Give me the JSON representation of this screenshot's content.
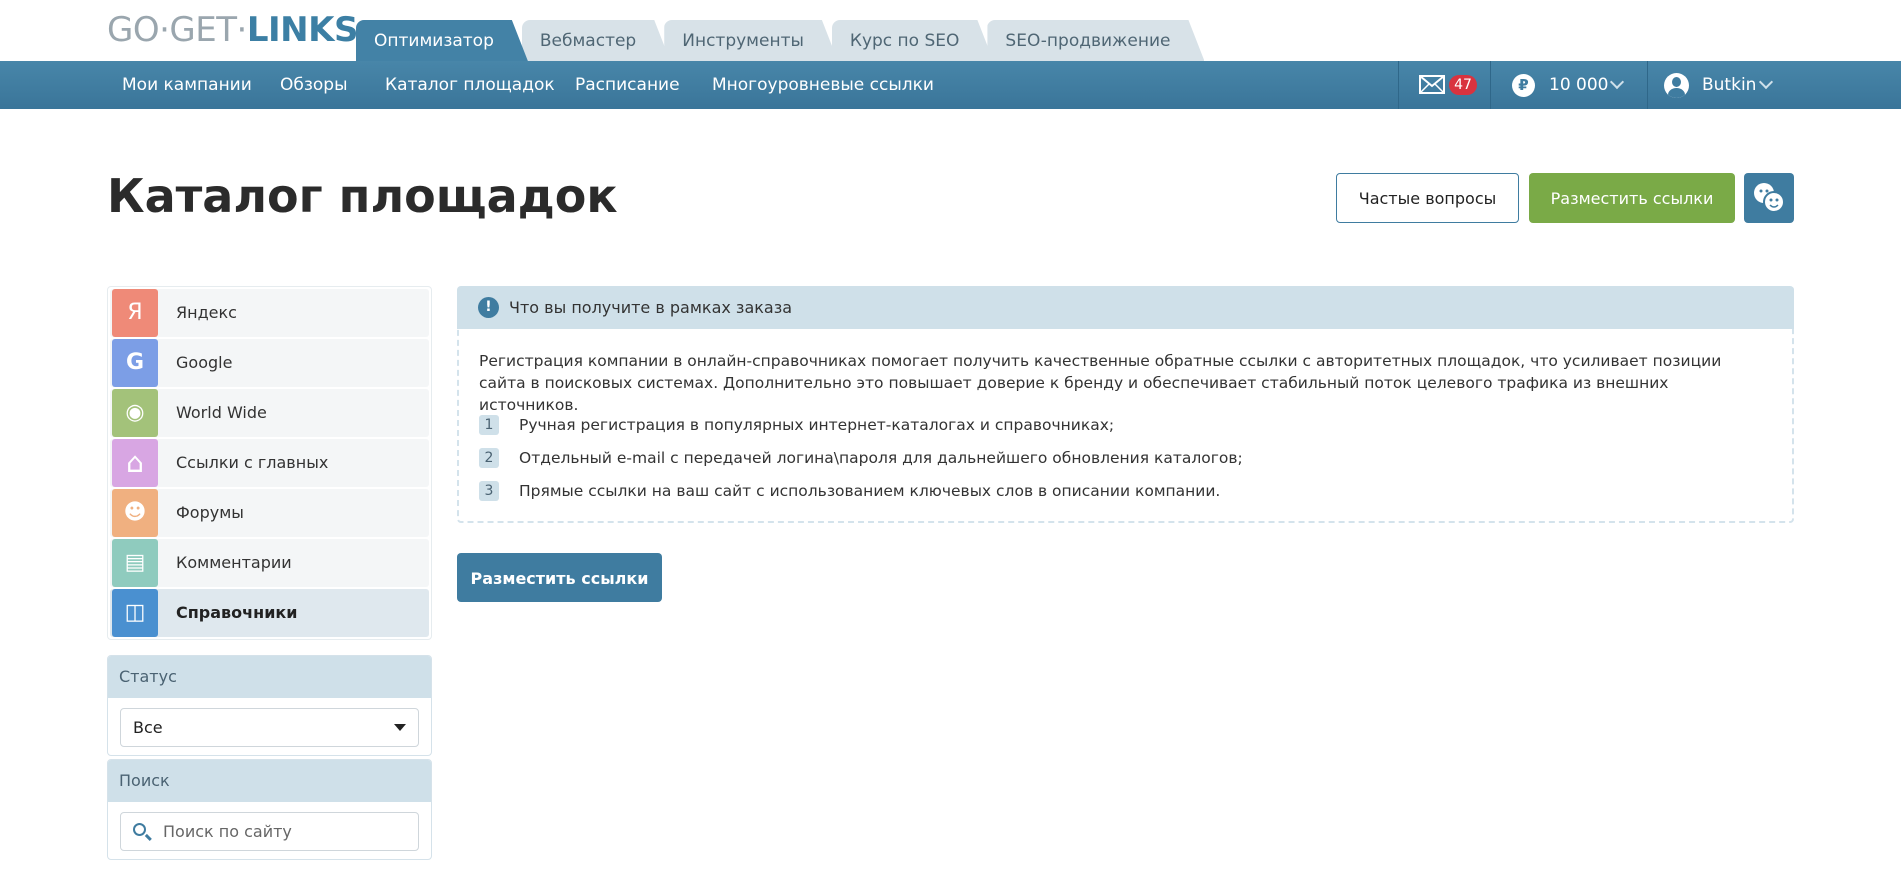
{
  "header": {
    "logo_part1": "GO·GET·",
    "logo_part2": "LINKS",
    "tabs": [
      {
        "label": "Оптимизатор",
        "active": true
      },
      {
        "label": "Вебмастер"
      },
      {
        "label": "Инструменты"
      },
      {
        "label": "Курс по SEO"
      },
      {
        "label": "SEO-продвижение"
      }
    ]
  },
  "nav": {
    "items": [
      "Мои кампании",
      "Обзоры",
      "Каталог площадок",
      "Расписание",
      "Многоуровневые ссылки"
    ],
    "mail_count": "47",
    "currency_symbol": "₽",
    "balance": "10 000",
    "username": "Butkin"
  },
  "page": {
    "title": "Каталог площадок",
    "faq_button": "Частые вопросы",
    "place_links_button": "Разместить ссылки"
  },
  "sidebar": {
    "categories": [
      {
        "label": "Яндекс",
        "icon": "yandex-icon",
        "glyph": "Я",
        "color": "#ef8a78"
      },
      {
        "label": "Google",
        "icon": "google-icon",
        "glyph": "G",
        "color": "#7c9ee6"
      },
      {
        "label": "World Wide",
        "icon": "globe-icon",
        "glyph": "◉",
        "color": "#a3c27a"
      },
      {
        "label": "Ссылки с главных",
        "icon": "home-icon",
        "glyph": "⌂",
        "color": "#d8a6e3"
      },
      {
        "label": "Форумы",
        "icon": "users-icon",
        "glyph": "☻",
        "color": "#f0b080"
      },
      {
        "label": "Комментарии",
        "icon": "comments-icon",
        "glyph": "▤",
        "color": "#8fcbbe"
      },
      {
        "label": "Справочники",
        "icon": "directory-icon",
        "glyph": "◫",
        "color": "#4a90d0",
        "active": true
      }
    ],
    "status": {
      "label": "Статус",
      "selected": "Все"
    },
    "search": {
      "label": "Поиск",
      "placeholder": "Поиск по сайту"
    }
  },
  "info": {
    "title": "Что вы получите в рамках заказа",
    "text": "Регистрация компании в онлайн-справочниках помогает получить качественные обратные ссылки с авторитетных площадок, что усиливает позиции сайта в поисковых системах. Дополнительно это повышает доверие к бренду и обеспечивает стабильный поток целевого трафика из внешних источников.",
    "items": [
      {
        "num": "1",
        "text": "Ручная регистрация в популярных интернет-каталогах и справочниках;"
      },
      {
        "num": "2",
        "text": "Отдельный e-mail с передачей логина\\пароля для дальнейшего обновления каталогов;"
      },
      {
        "num": "3",
        "text": "Прямые ссылки на ваш сайт с использованием ключевых слов в описании компании."
      }
    ],
    "action_button": "Разместить ссылки"
  }
}
